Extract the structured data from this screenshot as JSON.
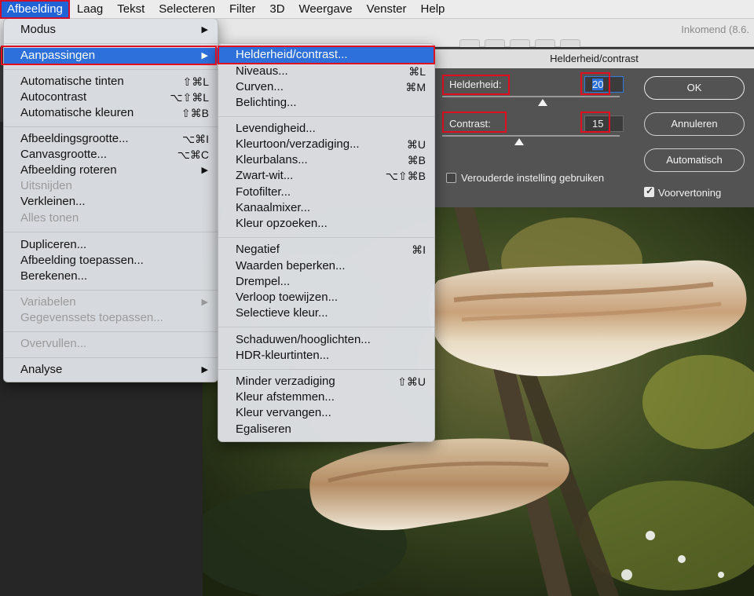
{
  "menubar": {
    "items": [
      "Afbeelding",
      "Laag",
      "Tekst",
      "Selecteren",
      "Filter",
      "3D",
      "Weergave",
      "Venster",
      "Help"
    ]
  },
  "app": {
    "doc_title": "Inkomend (8.6."
  },
  "menu_afbeelding": {
    "modus": "Modus",
    "aanpassingen": "Aanpassingen",
    "automatische_tinten": "Automatische tinten",
    "automatische_tinten_sc": "⇧⌘L",
    "autocontrast": "Autocontrast",
    "autocontrast_sc": "⌥⇧⌘L",
    "automatische_kleuren": "Automatische kleuren",
    "automatische_kleuren_sc": "⇧⌘B",
    "afbeeldingsgrootte": "Afbeeldingsgrootte...",
    "afbeeldingsgrootte_sc": "⌥⌘I",
    "canvasgrootte": "Canvasgrootte...",
    "canvasgrootte_sc": "⌥⌘C",
    "afbeelding_roteren": "Afbeelding roteren",
    "uitsnijden": "Uitsnijden",
    "verkleinen": "Verkleinen...",
    "alles_tonen": "Alles tonen",
    "dupliceren": "Dupliceren...",
    "afbeelding_toepassen": "Afbeelding toepassen...",
    "berekenen": "Berekenen...",
    "variabelen": "Variabelen",
    "gegevenssets_toepassen": "Gegevenssets toepassen...",
    "overvullen": "Overvullen...",
    "analyse": "Analyse"
  },
  "menu_aanpassingen": {
    "helderheid_contrast": "Helderheid/contrast...",
    "niveaus": "Niveaus...",
    "niveaus_sc": "⌘L",
    "curven": "Curven...",
    "curven_sc": "⌘M",
    "belichting": "Belichting...",
    "levendigheid": "Levendigheid...",
    "kleurtoon_verzadiging": "Kleurtoon/verzadiging...",
    "kleurtoon_verzadiging_sc": "⌘U",
    "kleurbalans": "Kleurbalans...",
    "kleurbalans_sc": "⌘B",
    "zwart_wit": "Zwart-wit...",
    "zwart_wit_sc": "⌥⇧⌘B",
    "fotofilter": "Fotofilter...",
    "kanaalmixer": "Kanaalmixer...",
    "kleur_opzoeken": "Kleur opzoeken...",
    "negatief": "Negatief",
    "negatief_sc": "⌘I",
    "waarden_beperken": "Waarden beperken...",
    "drempel": "Drempel...",
    "verloop_toewijzen": "Verloop toewijzen...",
    "selectieve_kleur": "Selectieve kleur...",
    "schaduwen_hooglichten": "Schaduwen/hooglichten...",
    "hdr_kleurtinten": "HDR-kleurtinten...",
    "minder_verzadiging": "Minder verzadiging",
    "minder_verzadiging_sc": "⇧⌘U",
    "kleur_afstemmen": "Kleur afstemmen...",
    "kleur_vervangen": "Kleur vervangen...",
    "egaliseren": "Egaliseren"
  },
  "dialog": {
    "title": "Helderheid/contrast",
    "brightness_label": "Helderheid:",
    "brightness_value": "20",
    "brightness_level": 20,
    "contrast_label": "Contrast:",
    "contrast_value": "15",
    "contrast_level": 15,
    "legacy_label": "Verouderde instelling gebruiken",
    "legacy_checked": false,
    "preview_label": "Voorvertoning",
    "preview_checked": true,
    "ok": "OK",
    "cancel": "Annuleren",
    "auto": "Automatisch"
  },
  "colors": {
    "menu_highlight": "#2d6fdb",
    "annotation_red": "#e01020",
    "dialog_bg": "#535353"
  }
}
